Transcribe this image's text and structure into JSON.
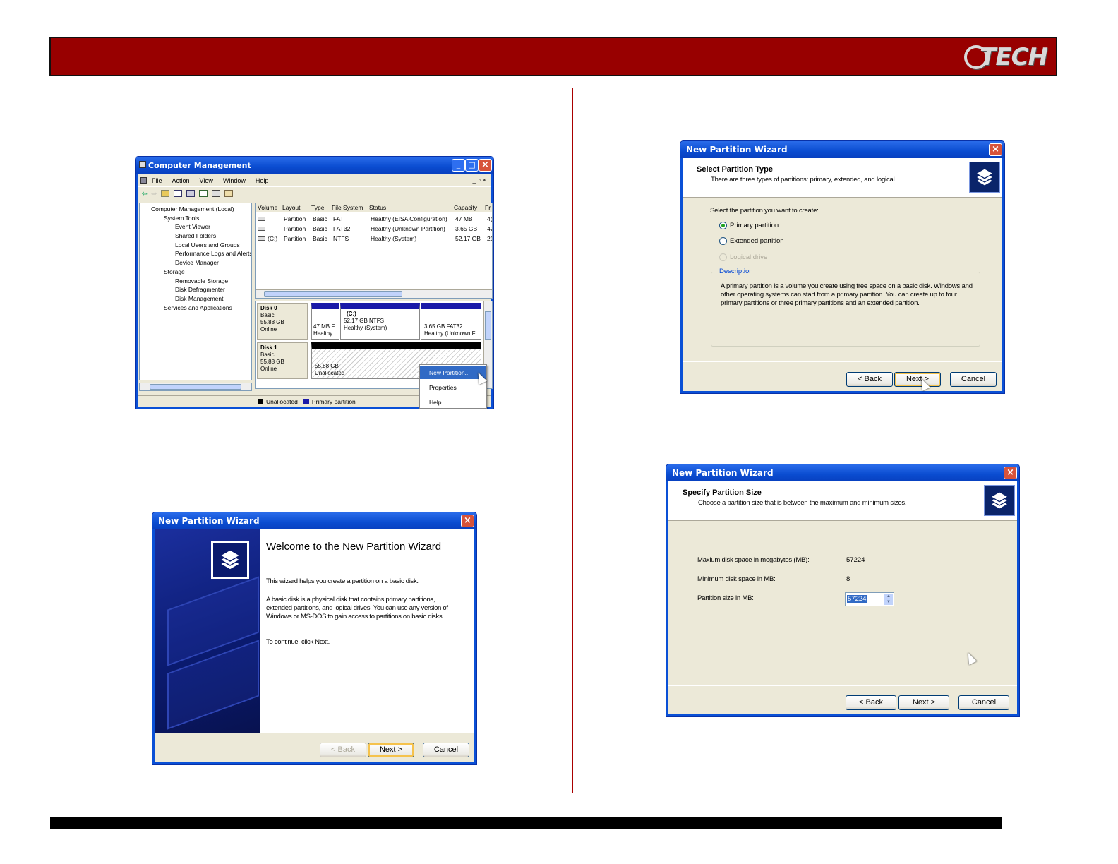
{
  "header": {
    "logo_text": "TECH",
    "colors": {
      "bar": "#980000",
      "divider": "#aa0000",
      "footer": "#000000"
    }
  },
  "cm": {
    "title": "Computer Management",
    "menu": [
      "File",
      "Action",
      "View",
      "Window",
      "Help"
    ],
    "tree": [
      {
        "label": "Computer Management (Local)",
        "level": 0
      },
      {
        "label": "System Tools",
        "level": 1
      },
      {
        "label": "Event Viewer",
        "level": 2
      },
      {
        "label": "Shared Folders",
        "level": 2
      },
      {
        "label": "Local Users and Groups",
        "level": 2
      },
      {
        "label": "Performance Logs and Alerts",
        "level": 2
      },
      {
        "label": "Device Manager",
        "level": 2
      },
      {
        "label": "Storage",
        "level": 1
      },
      {
        "label": "Removable Storage",
        "level": 2
      },
      {
        "label": "Disk Defragmenter",
        "level": 2
      },
      {
        "label": "Disk Management",
        "level": 2
      },
      {
        "label": "Services and Applications",
        "level": 1
      }
    ],
    "columns": [
      "Volume",
      "Layout",
      "Type",
      "File System",
      "Status",
      "Capacity",
      "Fr"
    ],
    "rows": [
      {
        "volume": "",
        "layout": "Partition",
        "type": "Basic",
        "fs": "FAT",
        "status": "Healthy (EISA Configuration)",
        "capacity": "47 MB",
        "fr": "4("
      },
      {
        "volume": "",
        "layout": "Partition",
        "type": "Basic",
        "fs": "FAT32",
        "status": "Healthy (Unknown Partition)",
        "capacity": "3.65 GB",
        "fr": "42"
      },
      {
        "volume": "(C:)",
        "layout": "Partition",
        "type": "Basic",
        "fs": "NTFS",
        "status": "Healthy (System)",
        "capacity": "52.17 GB",
        "fr": "21"
      }
    ],
    "disk0": {
      "name": "Disk 0",
      "type": "Basic",
      "size": "55.88 GB",
      "state": "Online",
      "p1": {
        "size": "47 MB F",
        "status": "Healthy"
      },
      "p2": {
        "name": "(C:)",
        "size": "52.17 GB NTFS",
        "status": "Healthy (System)"
      },
      "p3": {
        "size": "3.65 GB FAT32",
        "status": "Healthy (Unknown F"
      }
    },
    "disk1": {
      "name": "Disk 1",
      "type": "Basic",
      "size": "55.88 GB",
      "state": "Online",
      "p1": {
        "size": "55.88 GB",
        "status": "Unallocated"
      }
    },
    "legend": {
      "unallocated": "Unallocated",
      "primary": "Primary partition"
    },
    "context_menu": [
      "New Partition...",
      "Properties",
      "Help"
    ]
  },
  "wiz1": {
    "title": "New Partition Wizard",
    "heading": "Welcome to the New Partition Wizard",
    "p1": "This wizard helps you create a partition on a basic disk.",
    "p2": "A basic disk is a physical disk that contains primary partitions, extended partitions, and logical drives. You can use any version of Windows or MS-DOS to gain access to partitions on basic disks.",
    "p3": "To continue, click Next.",
    "back": "< Back",
    "next": "Next >",
    "cancel": "Cancel"
  },
  "wiz2": {
    "title": "New Partition Wizard",
    "heading": "Select Partition Type",
    "subheading": "There are three types of partitions: primary, extended, and logical.",
    "prompt": "Select the partition you want to create:",
    "opt1": "Primary partition",
    "opt2": "Extended partition",
    "opt3": "Logical drive",
    "desc_label": "Description",
    "desc": "A primary partition is a volume you create using free space on a basic disk. Windows and other operating systems can start from a primary partition. You can create up to four primary partitions or three primary partitions and an extended partition.",
    "back": "< Back",
    "next": "Next >",
    "cancel": "Cancel"
  },
  "wiz3": {
    "title": "New Partition Wizard",
    "heading": "Specify Partition Size",
    "subheading": "Choose a partition size that is between the maximum and minimum sizes.",
    "max_label": "Maxium disk space in megabytes (MB):",
    "max_value": "57224",
    "min_label": "Minimum disk space in MB:",
    "min_value": "8",
    "size_label": "Partition size in MB:",
    "size_value": "57224",
    "back": "< Back",
    "next": "Next >",
    "cancel": "Cancel"
  }
}
